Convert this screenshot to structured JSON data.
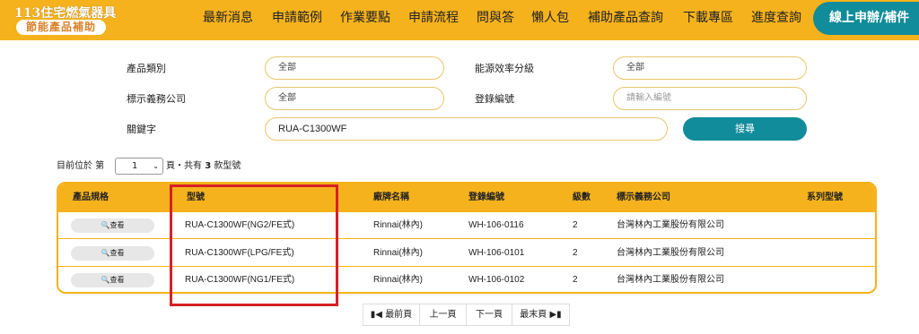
{
  "header": {
    "logo_top": "113住宅燃氣器具",
    "logo_bottom": "節能產品補助",
    "nav": [
      "最新消息",
      "申請範例",
      "作業要點",
      "申請流程",
      "問與答",
      "懶人包",
      "補助產品查詢",
      "下載專區",
      "進度查詢"
    ],
    "cta_label": "線上申辦/補件"
  },
  "filters": {
    "category_label": "產品類別",
    "category_value": "全部",
    "efficiency_label": "能源效率分級",
    "efficiency_value": "全部",
    "company_label": "標示義務公司",
    "company_value": "全部",
    "reg_label": "登錄編號",
    "reg_placeholder": "請輸入編號",
    "keyword_label": "關鍵字",
    "keyword_value": "RUA-C1300WF",
    "search_label": "搜尋"
  },
  "pageinfo": {
    "prefix": "目前位於 第",
    "page": "1",
    "suffix_a": "頁・共有",
    "count": "3",
    "suffix_b": "款型號"
  },
  "table": {
    "headers": [
      "產品規格",
      "型號",
      "廠牌名稱",
      "登錄編號",
      "級數",
      "標示義務公司",
      "系列型號"
    ],
    "view_label": "查看",
    "rows": [
      {
        "model": "RUA-C1300WF(NG2/FE式)",
        "brand": "Rinnai(林內)",
        "reg": "WH-106-0116",
        "level": "2",
        "company": "台灣林內工業股份有限公司",
        "series": ""
      },
      {
        "model": "RUA-C1300WF(LPG/FE式)",
        "brand": "Rinnai(林內)",
        "reg": "WH-106-0101",
        "level": "2",
        "company": "台灣林內工業股份有限公司",
        "series": ""
      },
      {
        "model": "RUA-C1300WF(NG1/FE式)",
        "brand": "Rinnai(林內)",
        "reg": "WH-106-0102",
        "level": "2",
        "company": "台灣林內工業股份有限公司",
        "series": ""
      }
    ]
  },
  "pagination": {
    "first": "最前頁",
    "prev": "上一頁",
    "next": "下一頁",
    "last": "最末頁"
  },
  "colors": {
    "brand_yellow": "#f5b21c",
    "teal": "#108c9a",
    "highlight_red": "#d62027"
  }
}
